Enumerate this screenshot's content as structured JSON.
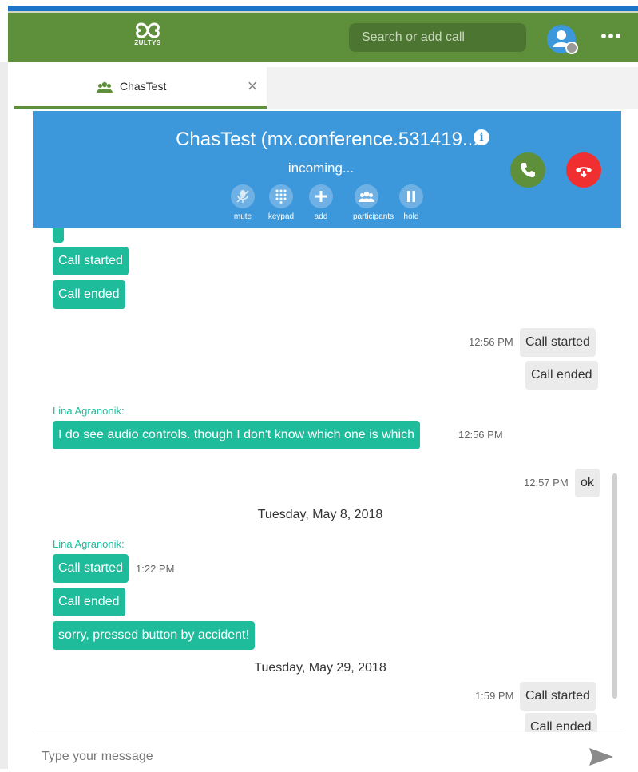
{
  "header": {
    "logo_text": "ZULTYS",
    "search_placeholder": "Search or add call",
    "more_label": "•••"
  },
  "tab": {
    "label": "ChasTest",
    "close": "×"
  },
  "call": {
    "title": "ChasTest (mx.conference.531419...",
    "info": "i",
    "status": "incoming...",
    "controls": [
      {
        "label": "mute",
        "icon": "mute-icon"
      },
      {
        "label": "keypad",
        "icon": "keypad-icon"
      },
      {
        "label": "add",
        "icon": "plus-icon"
      },
      {
        "label": "participants",
        "icon": "participants-icon"
      },
      {
        "label": "hold",
        "icon": "pause-icon"
      }
    ],
    "colors": {
      "banner": "#3c98da",
      "answer": "#5e8f3a",
      "reject": "#f03030"
    }
  },
  "messages": {
    "m1": "Call started",
    "m2": "Call ended",
    "m3_time": "12:56 PM",
    "m3": "Call started",
    "m4": "Call ended",
    "sender1": "Lina Agranonik:",
    "m5": "I do see audio controls. though I don't know which one is which",
    "m5_time": "12:56 PM",
    "m6_time": "12:57 PM",
    "m6": "ok",
    "date1": "Tuesday, May 8, 2018",
    "sender2": "Lina Agranonik:",
    "m7": "Call started",
    "m7_time": "1:22 PM",
    "m8": "Call ended",
    "m9": "sorry, pressed button by accident!",
    "date2": "Tuesday, May 29, 2018",
    "m10_time": "1:59 PM",
    "m10": "Call started",
    "m11": "Call ended"
  },
  "composer": {
    "placeholder": "Type your message"
  }
}
